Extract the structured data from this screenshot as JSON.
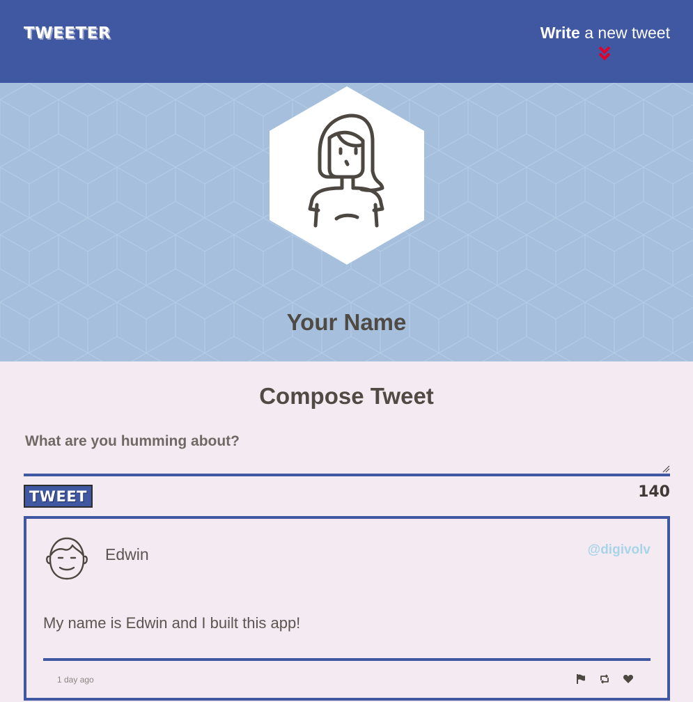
{
  "nav": {
    "brand": "TWEETER",
    "write_strong": "Write",
    "write_rest": "a new tweet",
    "chevron_icon": "double-chevron-down-icon",
    "chevron_color": "#e0002a",
    "background_color": "#4057a2"
  },
  "profile": {
    "name": "Your Name",
    "avatar_icon": "woman-avatar-icon",
    "background_color": "#a5bfdd"
  },
  "compose": {
    "title": "Compose Tweet",
    "placeholder": "What are you humming about?",
    "button_label": "TWEET",
    "counter": "140",
    "accent_color": "#4057a2"
  },
  "tweets": [
    {
      "name": "Edwin",
      "handle": "@digivolv",
      "text": "My name is Edwin and I built this app!",
      "time": "1 day ago",
      "avatar_icon": "man-avatar-icon",
      "actions": [
        "flag-icon",
        "retweet-icon",
        "heart-icon"
      ]
    }
  ],
  "colors": {
    "page_background": "#f4eaf1",
    "handle_color": "#a8d4ea",
    "text_color": "#4c4741"
  }
}
